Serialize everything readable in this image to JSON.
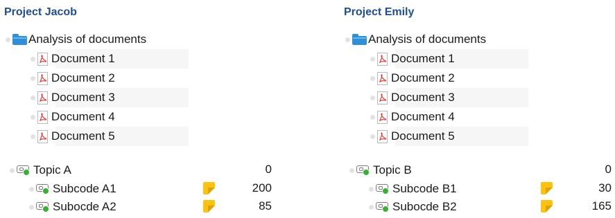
{
  "projects": [
    {
      "title": "Project Jacob",
      "folder": {
        "label": "Analysis of documents",
        "icon": "folder-icon"
      },
      "documents": [
        {
          "label": "Document 1",
          "icon": "pdf-icon"
        },
        {
          "label": "Document 2",
          "icon": "pdf-icon"
        },
        {
          "label": "Document 3",
          "icon": "pdf-icon"
        },
        {
          "label": "Document 4",
          "icon": "pdf-icon"
        },
        {
          "label": "Document 5",
          "icon": "pdf-icon"
        }
      ],
      "topic": {
        "label": "Topic A",
        "count": "0",
        "icon": "code-icon"
      },
      "subcodes": [
        {
          "label": "Subcode A1",
          "count": "200",
          "icon": "code-icon",
          "memo": "memo-icon"
        },
        {
          "label": "Subocde A2",
          "count": "85",
          "icon": "code-icon",
          "memo": "memo-icon"
        }
      ]
    },
    {
      "title": "Project Emily",
      "folder": {
        "label": "Analysis of documents",
        "icon": "folder-icon"
      },
      "documents": [
        {
          "label": "Document 1",
          "icon": "pdf-icon"
        },
        {
          "label": "Document 2",
          "icon": "pdf-icon"
        },
        {
          "label": "Document 3",
          "icon": "pdf-icon"
        },
        {
          "label": "Document 4",
          "icon": "pdf-icon"
        },
        {
          "label": "Document 5",
          "icon": "pdf-icon"
        }
      ],
      "topic": {
        "label": "Topic B",
        "count": "0",
        "icon": "code-icon"
      },
      "subcodes": [
        {
          "label": "Subcode B1",
          "count": "30",
          "icon": "code-icon",
          "memo": "memo-icon"
        },
        {
          "label": "Subocde B2",
          "count": "165",
          "icon": "code-icon",
          "memo": "memo-icon"
        }
      ]
    }
  ],
  "colors": {
    "title": "#1f4e8f",
    "folder": "#2f8fd8",
    "pdf_red": "#d8312a",
    "code_green": "#35b233",
    "memo_yellow": "#ffc20e"
  }
}
